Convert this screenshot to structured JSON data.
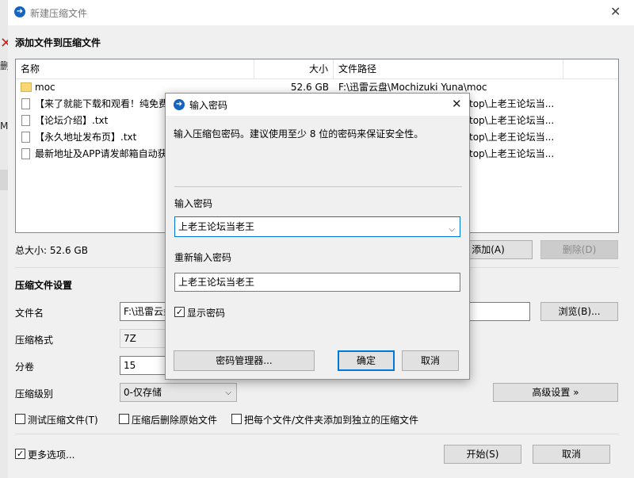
{
  "window": {
    "title": "新建压缩文件",
    "close_glyph": "✕"
  },
  "background": {
    "left_edge_texts": [
      "删",
      "Mo"
    ]
  },
  "add_section": {
    "title": "添加文件到压缩文件",
    "columns": {
      "name": "名称",
      "size": "大小",
      "path": "文件路径"
    },
    "rows": [
      {
        "icon": "folder-icon",
        "name": "moc",
        "size": "52.6 GB",
        "path": "F:\\迅雷云盘\\Mochizuki Yuna\\moc"
      },
      {
        "icon": "file-icon",
        "name": "【来了就能下载和观看！纯免费",
        "size": "",
        "path": "top\\上老王论坛当..."
      },
      {
        "icon": "file-icon",
        "name": "【论坛介绍】.txt",
        "size": "",
        "path": "top\\上老王论坛当..."
      },
      {
        "icon": "file-icon",
        "name": "【永久地址发布页】.txt",
        "size": "",
        "path": "top\\上老王论坛当..."
      },
      {
        "icon": "file-icon",
        "name": "最新地址及APP请发邮箱自动获",
        "size": "",
        "path": "top\\上老王论坛当..."
      }
    ],
    "total_size": "总大小: 52.6 GB",
    "add_button": "添加(A)",
    "delete_button": "删除(D)"
  },
  "settings": {
    "title": "压缩文件设置",
    "filename_label": "文件名",
    "filename_value": "F:\\迅雷云盘",
    "browse_button": "浏览(B)...",
    "format_label": "压缩格式",
    "format_value": "7Z",
    "volume_label": "分卷",
    "volume_value": "15",
    "level_label": "压缩级别",
    "level_value": "0-仅存储",
    "advanced_button": "高级设置 »",
    "options": {
      "test": "测试压缩文件(T)",
      "delete_after": "压缩后删除原始文件",
      "separate": "把每个文件/文件夹添加到独立的压缩文件"
    },
    "more_options": "更多选项...",
    "start_button": "开始(S)",
    "cancel_button": "取消"
  },
  "password_dialog": {
    "title": "输入密码",
    "close_glyph": "✕",
    "description": "输入压缩包密码。建议使用至少 8 位的密码来保证安全性。",
    "password_label": "输入密码",
    "password_value": "上老王论坛当老王",
    "confirm_label": "重新输入密码",
    "confirm_value": "上老王论坛当老王",
    "show_password": "显示密码",
    "manager_button": "密码管理器...",
    "ok_button": "确定",
    "cancel_button": "取消"
  },
  "colors": {
    "accent": "#0078d7",
    "app_icon": "#1565c0"
  }
}
